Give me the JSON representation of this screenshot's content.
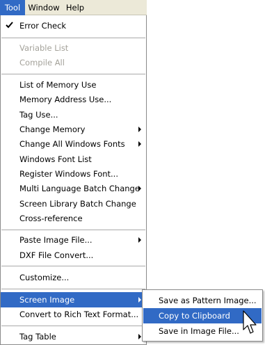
{
  "menubar": {
    "items": [
      "Tool",
      "Window",
      "Help"
    ]
  },
  "menu": {
    "error_check": "Error Check",
    "variable_list": "Variable List",
    "compile_all": "Compile All",
    "list_memory_use": "List of Memory Use",
    "memory_address_use": "Memory Address Use...",
    "tag_use": "Tag Use...",
    "change_memory": "Change Memory",
    "change_all_windows_fonts": "Change All Windows Fonts",
    "windows_font_list": "Windows Font List",
    "register_windows_font": "Register Windows Font...",
    "multi_language_batch_change": "Multi Language Batch Change",
    "screen_library_batch_change": "Screen Library Batch Change",
    "cross_reference": "Cross-reference",
    "paste_image_file": "Paste Image File...",
    "dxf_file_convert": "DXF File Convert...",
    "customize": "Customize...",
    "screen_image": "Screen Image",
    "convert_rtf": "Convert to Rich Text Format...",
    "tag_table": "Tag Table"
  },
  "submenu": {
    "save_pattern": "Save as Pattern Image...",
    "copy_clipboard": "Copy to Clipboard",
    "save_image_file": "Save in Image File..."
  },
  "colors": {
    "highlight": "#316ac5",
    "menubar_bg": "#ece9d8",
    "disabled_text": "#a4a29a"
  },
  "icons": {
    "check": "checkmark-icon",
    "submenu_arrow": "chevron-right-icon",
    "cursor": "mouse-pointer-icon"
  }
}
